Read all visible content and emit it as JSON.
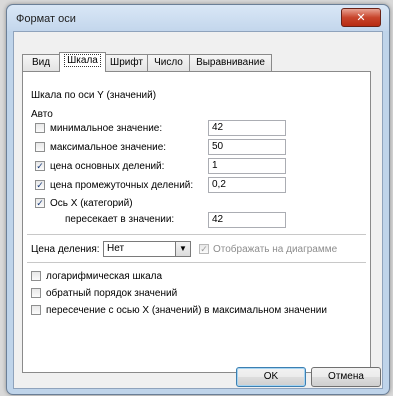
{
  "window": {
    "title": "Формат оси",
    "close_glyph": "✕"
  },
  "tabs": [
    {
      "label": "Вид"
    },
    {
      "label": "Шкала",
      "active": true
    },
    {
      "label": "Шрифт"
    },
    {
      "label": "Число"
    },
    {
      "label": "Выравнивание"
    }
  ],
  "scale": {
    "heading": "Шкала по оси Y (значений)",
    "auto_label": "Авто",
    "min": {
      "label": "минимальное значение:",
      "checked": false,
      "value": "42"
    },
    "max": {
      "label": "максимальное значение:",
      "checked": false,
      "value": "50"
    },
    "major": {
      "label": "цена основных делений:",
      "checked": true,
      "value": "1"
    },
    "minor": {
      "label": "цена промежуточных делений:",
      "checked": true,
      "value": "0,2"
    },
    "xaxis": {
      "label": "Ось X (категорий)",
      "checked": true
    },
    "crosses": {
      "label": "пересекает в значении:",
      "value": "42"
    }
  },
  "units": {
    "label": "Цена деления:",
    "selected": "Нет",
    "show_label": "Отображать на диаграмме",
    "show_checked": true
  },
  "options": {
    "log_scale": {
      "label": "логарифмическая шкала",
      "checked": false
    },
    "reverse": {
      "label": "обратный порядок значений",
      "checked": false
    },
    "cross_max": {
      "label": "пересечение с осью X (значений) в максимальном значении",
      "checked": false
    }
  },
  "buttons": {
    "ok": "OK",
    "cancel": "Отмена"
  },
  "glyphs": {
    "check": "✓",
    "dropdown": "▼"
  }
}
